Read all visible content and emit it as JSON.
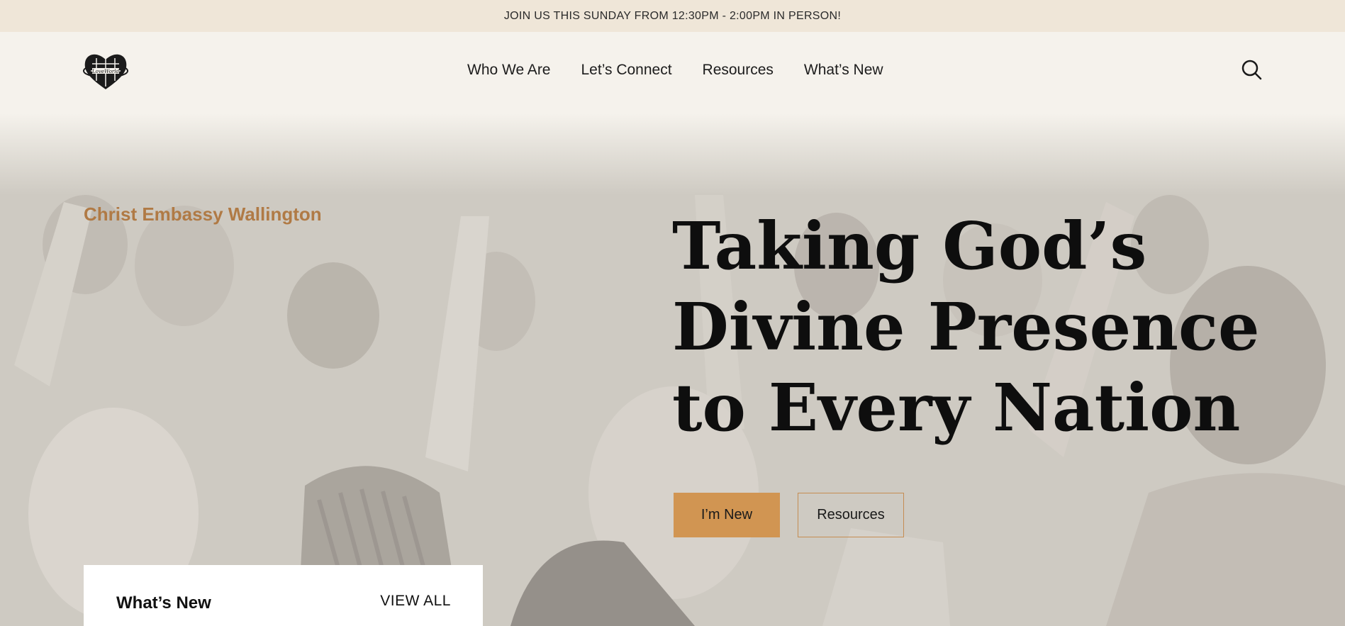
{
  "announcement": {
    "text": "JOIN US THIS SUNDAY FROM 12:30PM - 2:00PM IN PERSON!"
  },
  "header": {
    "logo_icon": "loveworld-heart-globe-logo",
    "nav": [
      {
        "label": "Who We Are"
      },
      {
        "label": "Let’s Connect"
      },
      {
        "label": "Resources"
      },
      {
        "label": "What’s New"
      }
    ],
    "search_icon": "search-icon"
  },
  "hero": {
    "church_name": "Christ Embassy Wallington",
    "headline": "Taking God’s Divine Presence to Every Nation",
    "primary_button": "I’m New",
    "secondary_button": "Resources",
    "background": "grayscale crowd worshipping with raised hands"
  },
  "whats_new_card": {
    "title": "What’s New",
    "view_all": "VIEW ALL"
  },
  "colors": {
    "announcement_bg": "#efe6d8",
    "accent": "#d19552",
    "church_name": "#b07a45",
    "page_bg": "#f5f2ec"
  }
}
